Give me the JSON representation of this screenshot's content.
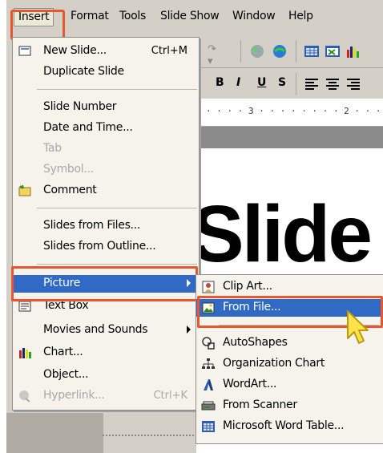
{
  "menubar": {
    "items": [
      "Insert",
      "Format",
      "Tools",
      "Slide Show",
      "Window",
      "Help"
    ],
    "active": "Insert"
  },
  "toolbar": {
    "formatting": [
      "B",
      "I",
      "U",
      "S"
    ]
  },
  "ruler": {
    "text": "· · · · 3 · · · · · · · · 2 · · · ·"
  },
  "slide": {
    "text": "Slide"
  },
  "insert_menu": {
    "new_slide": {
      "label": "New Slide...",
      "shortcut": "Ctrl+M",
      "icon": "new-slide-icon"
    },
    "duplicate_slide": {
      "label": "Duplicate Slide"
    },
    "slide_number": {
      "label": "Slide Number"
    },
    "date_time": {
      "label": "Date and Time..."
    },
    "tab": {
      "label": "Tab"
    },
    "symbol": {
      "label": "Symbol..."
    },
    "comment": {
      "label": "Comment",
      "icon": "comment-icon"
    },
    "slides_from_files": {
      "label": "Slides from Files..."
    },
    "slides_from_outline": {
      "label": "Slides from Outline..."
    },
    "picture": {
      "label": "Picture"
    },
    "text_box": {
      "label": "Text Box",
      "icon": "text-box-icon"
    },
    "movies_sounds": {
      "label": "Movies and Sounds"
    },
    "chart": {
      "label": "Chart...",
      "icon": "chart-icon"
    },
    "object": {
      "label": "Object..."
    },
    "hyperlink": {
      "label": "Hyperlink...",
      "shortcut": "Ctrl+K",
      "icon": "hyperlink-icon"
    }
  },
  "picture_submenu": {
    "clip_art": {
      "label": "Clip Art...",
      "icon": "clip-art-icon"
    },
    "from_file": {
      "label": "From File...",
      "icon": "from-file-icon"
    },
    "autoshapes": {
      "label": "AutoShapes",
      "icon": "autoshapes-icon"
    },
    "org_chart": {
      "label": "Organization Chart",
      "icon": "org-chart-icon"
    },
    "wordart": {
      "label": "WordArt...",
      "icon": "wordart-icon"
    },
    "from_scanner": {
      "label": "From Scanner",
      "icon": "scanner-icon"
    },
    "word_table": {
      "label": "Microsoft Word Table...",
      "icon": "word-table-icon"
    }
  },
  "colors": {
    "highlight": "#316ac5",
    "callout": "#e8572c",
    "menu_bg": "#f5f3ec",
    "chrome": "#d4d0c8"
  }
}
